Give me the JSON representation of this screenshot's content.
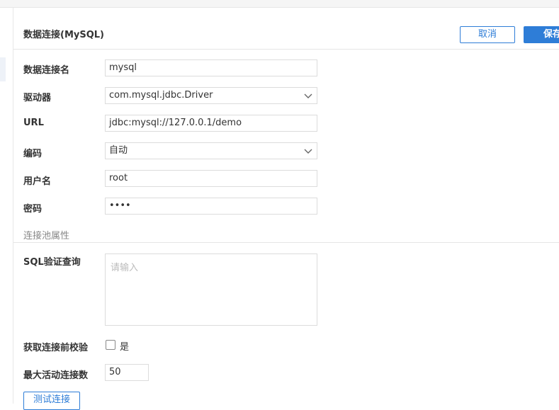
{
  "header": {
    "title": "数据连接(MySQL)",
    "cancel_label": "取消",
    "save_label": "保存"
  },
  "form": {
    "name_label": "数据连接名",
    "name_value": "mysql",
    "driver_label": "驱动器",
    "driver_value": "com.mysql.jdbc.Driver",
    "url_label": "URL",
    "url_value": "jdbc:mysql://127.0.0.1/demo",
    "encoding_label": "编码",
    "encoding_value": "自动",
    "user_label": "用户名",
    "user_value": "root",
    "password_label": "密码",
    "password_value": "••••"
  },
  "pool": {
    "section_title": "连接池属性",
    "sql_label": "SQL验证查询",
    "sql_placeholder": "请输入",
    "precheck_label": "获取连接前校验",
    "precheck_option": "是",
    "precheck_checked": false,
    "max_active_label": "最大活动连接数",
    "max_active_value": "50",
    "test_button_label": "测试连接"
  },
  "icons": {
    "dropdown": "chevron-down-icon",
    "checkbox": "checkbox-icon"
  },
  "colors": {
    "accent": "#2e7dd7",
    "border": "#dcdcdc",
    "muted_text": "#888888"
  }
}
